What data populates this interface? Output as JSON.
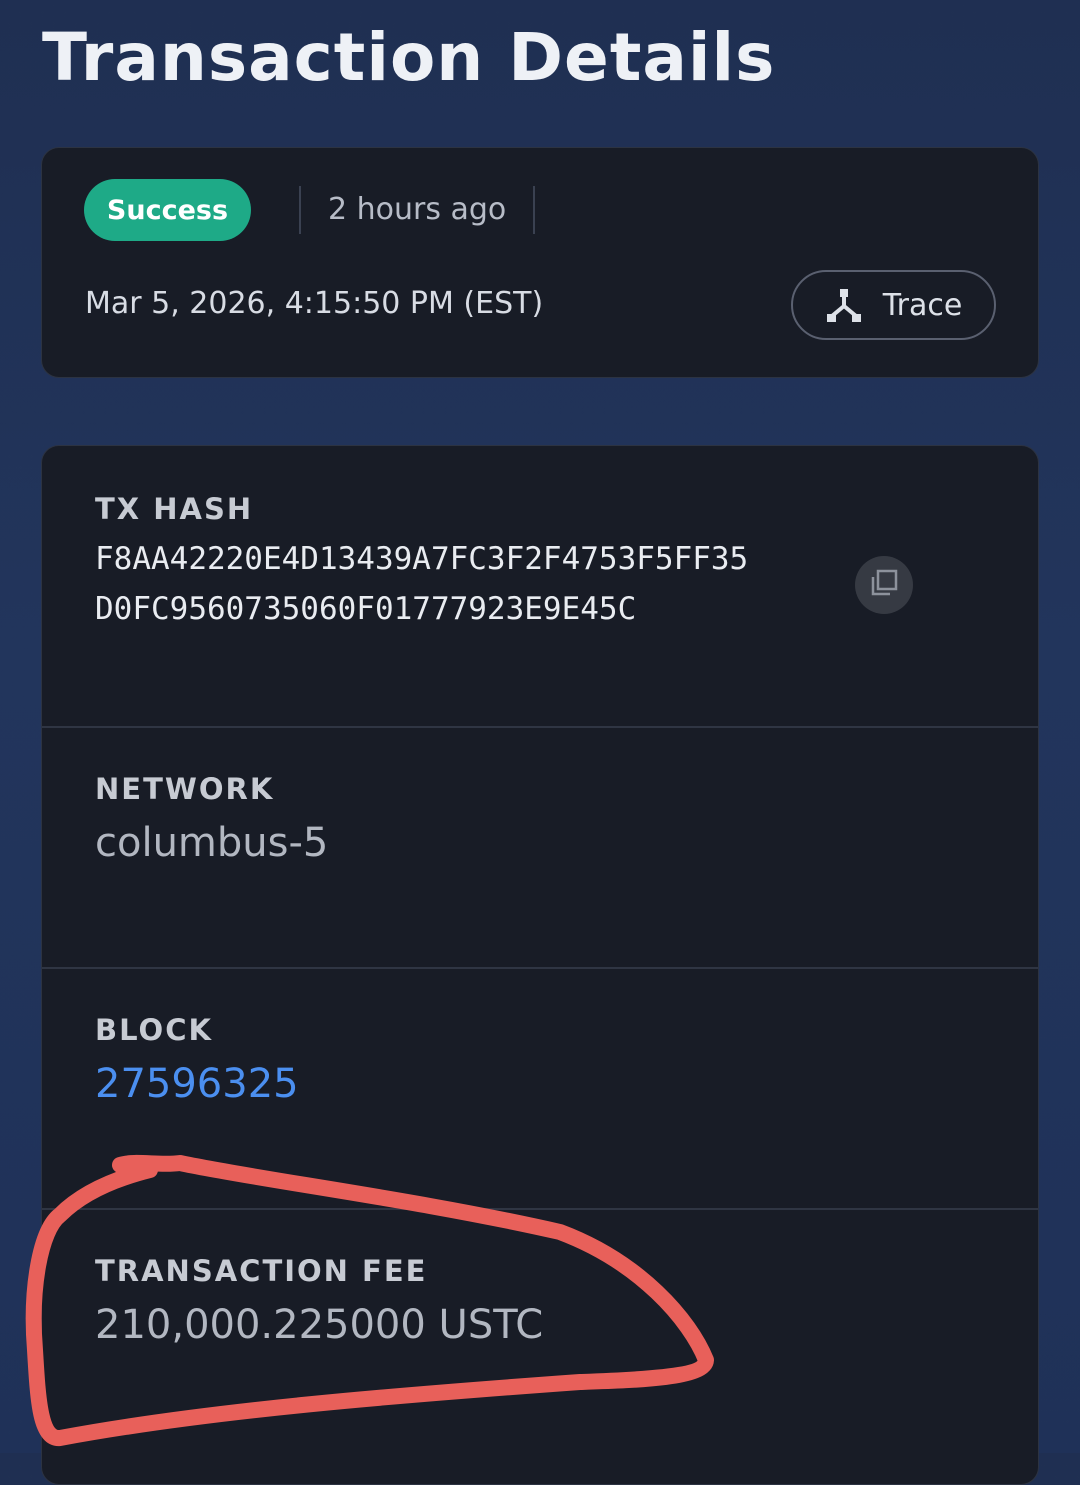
{
  "page": {
    "title": "Transaction Details"
  },
  "status": {
    "badge": "Success",
    "badge_color": "#1eaa87",
    "time_ago": "2 hours ago",
    "timestamp": "Mar 5, 2026, 4:15:50 PM (EST)",
    "trace_label": "Trace",
    "trace_icon": "trace-branch-icon"
  },
  "details": {
    "tx_hash": {
      "label": "TX HASH",
      "line1": "F8AA42220E4D13439A7FC3F2F4753F5FF35",
      "line2": "D0FC9560735060F01777923E9E45C",
      "copy_icon": "copy-icon"
    },
    "network": {
      "label": "NETWORK",
      "value": "columbus-5"
    },
    "block": {
      "label": "BLOCK",
      "value": "27596325",
      "link_color": "#4b8ff0"
    },
    "fee": {
      "label": "TRANSACTION FEE",
      "value": "210,000.225000 USTC"
    }
  },
  "annotation": {
    "shape": "hand-drawn circle around transaction fee",
    "color": "#e8605a"
  }
}
